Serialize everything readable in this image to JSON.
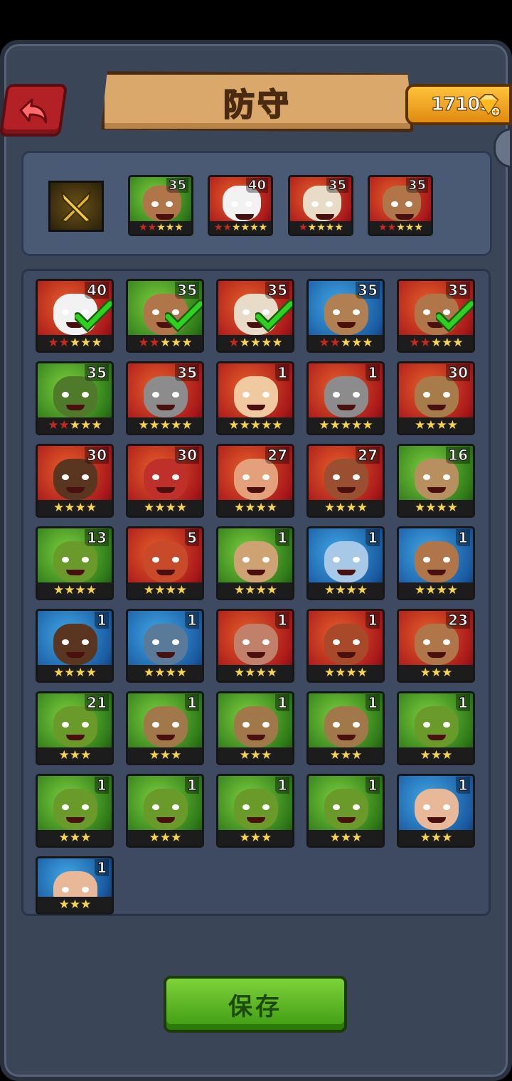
{
  "header": {
    "title": "防守",
    "gems": "17105"
  },
  "save_label": "保存",
  "colors": {
    "accent_red": "#b32026",
    "gold": "#f7d44a",
    "green_btn": "#5cb825",
    "check": "#27c21a"
  },
  "team": [
    {
      "level": "35",
      "stars": 5,
      "red": 2,
      "bg": "green",
      "skin": "#b0764a"
    },
    {
      "level": "40",
      "stars": 6,
      "red": 2,
      "bg": "red",
      "skin": "#f2f2f2"
    },
    {
      "level": "35",
      "stars": 5,
      "red": 1,
      "bg": "red",
      "skin": "#e8dcc8"
    },
    {
      "level": "35",
      "stars": 5,
      "red": 2,
      "bg": "red",
      "skin": "#b0764a"
    }
  ],
  "roster": [
    {
      "level": "40",
      "stars": 5,
      "red": 2,
      "bg": "red",
      "skin": "#f2f2f2",
      "checked": true
    },
    {
      "level": "35",
      "stars": 5,
      "red": 2,
      "bg": "green",
      "skin": "#b0764a",
      "checked": true
    },
    {
      "level": "35",
      "stars": 5,
      "red": 1,
      "bg": "red",
      "skin": "#e8dcc8",
      "checked": true
    },
    {
      "level": "35",
      "stars": 5,
      "red": 2,
      "bg": "blue",
      "skin": "#b08052",
      "checked": false
    },
    {
      "level": "35",
      "stars": 5,
      "red": 2,
      "bg": "red",
      "skin": "#b0764a",
      "checked": true
    },
    {
      "level": "35",
      "stars": 5,
      "red": 2,
      "bg": "green",
      "skin": "#4f7a2a",
      "checked": false
    },
    {
      "level": "35",
      "stars": 5,
      "red": 0,
      "bg": "red",
      "skin": "#8c8c8c",
      "checked": false
    },
    {
      "level": "1",
      "stars": 5,
      "red": 0,
      "bg": "red",
      "skin": "#f1c9a0",
      "checked": false
    },
    {
      "level": "1",
      "stars": 5,
      "red": 0,
      "bg": "red",
      "skin": "#8c8c8c",
      "checked": false
    },
    {
      "level": "30",
      "stars": 4,
      "red": 0,
      "bg": "red",
      "skin": "#a87c4a",
      "checked": false
    },
    {
      "level": "30",
      "stars": 4,
      "red": 0,
      "bg": "red",
      "skin": "#5a3520",
      "checked": false
    },
    {
      "level": "30",
      "stars": 4,
      "red": 0,
      "bg": "red",
      "skin": "#c0302a",
      "checked": false
    },
    {
      "level": "27",
      "stars": 4,
      "red": 0,
      "bg": "red",
      "skin": "#e4a07a",
      "checked": false
    },
    {
      "level": "27",
      "stars": 4,
      "red": 0,
      "bg": "red",
      "skin": "#9a5030",
      "checked": false
    },
    {
      "level": "16",
      "stars": 4,
      "red": 0,
      "bg": "green",
      "skin": "#b89060",
      "checked": false
    },
    {
      "level": "13",
      "stars": 4,
      "red": 0,
      "bg": "green",
      "skin": "#6a9a2a",
      "checked": false
    },
    {
      "level": "5",
      "stars": 4,
      "red": 0,
      "bg": "red",
      "skin": "#c84a2a",
      "checked": false
    },
    {
      "level": "1",
      "stars": 4,
      "red": 0,
      "bg": "green",
      "skin": "#cfa274",
      "checked": false
    },
    {
      "level": "1",
      "stars": 4,
      "red": 0,
      "bg": "blue",
      "skin": "#a8c8e8",
      "checked": false
    },
    {
      "level": "1",
      "stars": 4,
      "red": 0,
      "bg": "blue",
      "skin": "#b0764a",
      "checked": false
    },
    {
      "level": "1",
      "stars": 4,
      "red": 0,
      "bg": "blue",
      "skin": "#5a3520",
      "checked": false
    },
    {
      "level": "1",
      "stars": 4,
      "red": 0,
      "bg": "blue",
      "skin": "#5a7a9a",
      "checked": false
    },
    {
      "level": "1",
      "stars": 4,
      "red": 0,
      "bg": "red",
      "skin": "#c0806a",
      "checked": false
    },
    {
      "level": "1",
      "stars": 4,
      "red": 0,
      "bg": "red",
      "skin": "#a84a2a",
      "checked": false
    },
    {
      "level": "23",
      "stars": 3,
      "red": 0,
      "bg": "red",
      "skin": "#b0764a",
      "checked": false
    },
    {
      "level": "21",
      "stars": 3,
      "red": 0,
      "bg": "green",
      "skin": "#6a9a2a",
      "checked": false
    },
    {
      "level": "1",
      "stars": 3,
      "red": 0,
      "bg": "green",
      "skin": "#a0784a",
      "checked": false
    },
    {
      "level": "1",
      "stars": 3,
      "red": 0,
      "bg": "green",
      "skin": "#a0784a",
      "checked": false
    },
    {
      "level": "1",
      "stars": 3,
      "red": 0,
      "bg": "green",
      "skin": "#a0784a",
      "checked": false
    },
    {
      "level": "1",
      "stars": 3,
      "red": 0,
      "bg": "green",
      "skin": "#6a9a2a",
      "checked": false
    },
    {
      "level": "1",
      "stars": 3,
      "red": 0,
      "bg": "green",
      "skin": "#6a9a2a",
      "checked": false
    },
    {
      "level": "1",
      "stars": 3,
      "red": 0,
      "bg": "green",
      "skin": "#6a9a2a",
      "checked": false
    },
    {
      "level": "1",
      "stars": 3,
      "red": 0,
      "bg": "green",
      "skin": "#6a9a2a",
      "checked": false
    },
    {
      "level": "1",
      "stars": 3,
      "red": 0,
      "bg": "green",
      "skin": "#6a9a2a",
      "checked": false
    },
    {
      "level": "1",
      "stars": 3,
      "red": 0,
      "bg": "blue",
      "skin": "#e8b898",
      "checked": false
    },
    {
      "level": "1",
      "stars": 3,
      "red": 0,
      "bg": "blue",
      "skin": "#e8b898",
      "checked": false
    }
  ]
}
